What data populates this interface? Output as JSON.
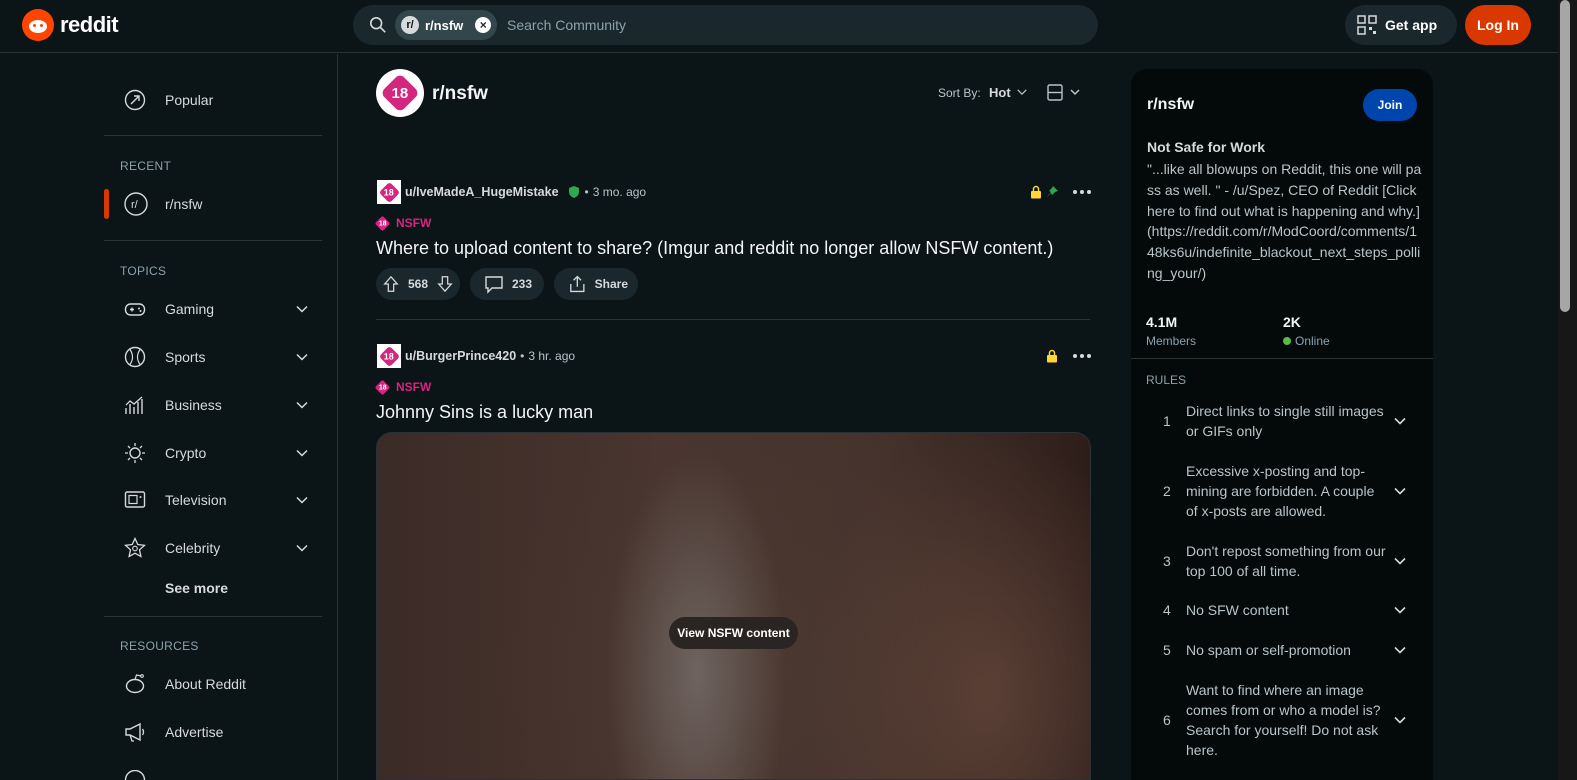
{
  "header": {
    "logo_text": "reddit",
    "search_chip": "r/nsfw",
    "search_placeholder": "Search Community",
    "get_app": "Get app",
    "login": "Log In"
  },
  "leftnav": {
    "popular": "Popular",
    "recent_title": "RECENT",
    "recent_item": "r/nsfw",
    "topics_title": "TOPICS",
    "topics": [
      "Gaming",
      "Sports",
      "Business",
      "Crypto",
      "Television",
      "Celebrity"
    ],
    "see_more": "See more",
    "resources_title": "RESOURCES",
    "resources": [
      "About Reddit",
      "Advertise"
    ]
  },
  "main": {
    "subreddit": "r/nsfw",
    "avatar_badge": "18",
    "sort_label": "Sort By:",
    "sort_value": "Hot",
    "posts": [
      {
        "author": "u/IveMadeA_HugeMistake",
        "time": "3 mo. ago",
        "tag": "NSFW",
        "title": "Where to upload content to share? (Imgur and reddit no longer allow NSFW content.)",
        "votes": "568",
        "comments": "233",
        "share": "Share"
      },
      {
        "author": "u/BurgerPrince420",
        "time": "3 hr. ago",
        "tag": "NSFW",
        "title": "Johnny Sins is a lucky man",
        "view_nsfw": "View NSFW content"
      }
    ]
  },
  "sidebar": {
    "title": "r/nsfw",
    "join": "Join",
    "name": "Not Safe for Work",
    "description": "\"...like all blowups on Reddit, this one will pass as well. \" - /u/Spez, CEO of Reddit [Click here to find out what is happening and why.](https://reddit.com/r/ModCoord/comments/148ks6u/indefinite_blackout_next_steps_polling_your/)",
    "members_count": "4.1M",
    "members_label": "Members",
    "online_count": "2K",
    "online_label": "Online",
    "rules_title": "RULES",
    "rules": [
      {
        "num": "1",
        "text": "Direct links to single still images or GIFs only"
      },
      {
        "num": "2",
        "text": "Excessive x-posting and top-mining are forbidden. A couple of x-posts are allowed."
      },
      {
        "num": "3",
        "text": "Don't repost something from our top 100 of all time."
      },
      {
        "num": "4",
        "text": "No SFW content"
      },
      {
        "num": "5",
        "text": "No spam or self-promotion"
      },
      {
        "num": "6",
        "text": "Want to find where an image comes from or who a model is? Search for yourself! Do not ask here."
      }
    ]
  },
  "colors": {
    "background": "#0b1416",
    "accent": "#d93900",
    "nsfw": "#d4267f",
    "join": "#0045ac",
    "online": "#55bd46"
  }
}
